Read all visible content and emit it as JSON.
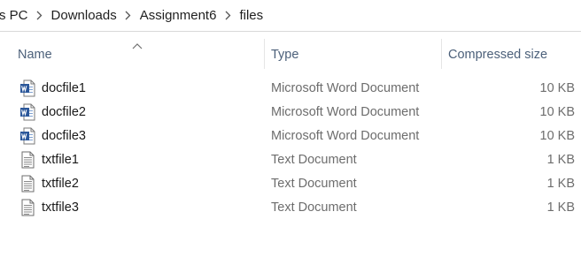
{
  "breadcrumb": {
    "items": [
      {
        "label": "s PC"
      },
      {
        "label": "Downloads"
      },
      {
        "label": "Assignment6"
      },
      {
        "label": "files"
      }
    ]
  },
  "columns": {
    "name": "Name",
    "type": "Type",
    "size": "Compressed size",
    "sort_icon": "sort-ascending-chevron"
  },
  "files": [
    {
      "name": "docfile1",
      "type": "Microsoft Word Document",
      "size": "10 KB",
      "icon": "word-document-icon"
    },
    {
      "name": "docfile2",
      "type": "Microsoft Word Document",
      "size": "10 KB",
      "icon": "word-document-icon"
    },
    {
      "name": "docfile3",
      "type": "Microsoft Word Document",
      "size": "10 KB",
      "icon": "word-document-icon"
    },
    {
      "name": "txtfile1",
      "type": "Text Document",
      "size": "1 KB",
      "icon": "text-document-icon"
    },
    {
      "name": "txtfile2",
      "type": "Text Document",
      "size": "1 KB",
      "icon": "text-document-icon"
    },
    {
      "name": "txtfile3",
      "type": "Text Document",
      "size": "1 KB",
      "icon": "text-document-icon"
    }
  ],
  "colors": {
    "header_text": "#4c607a",
    "secondary_text": "#6d6d6d",
    "word_blue": "#2b579a"
  }
}
